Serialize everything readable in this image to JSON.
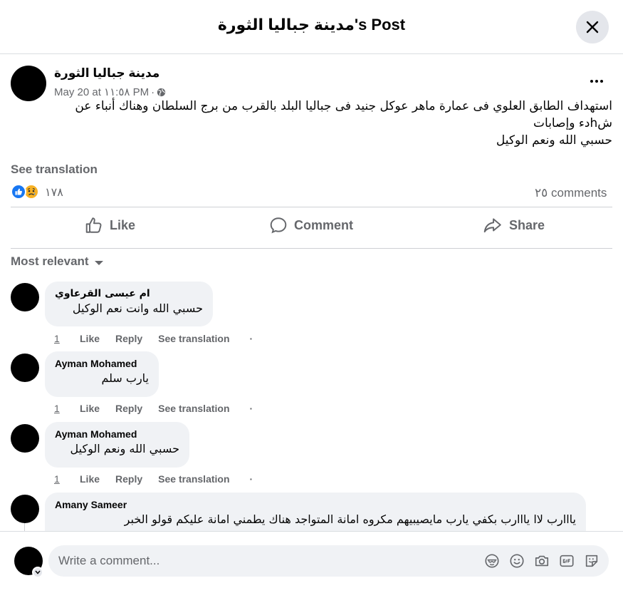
{
  "header": {
    "title": "مدينة جباليا الثورة's Post"
  },
  "post": {
    "author": "مدينة جباليا الثورة",
    "date": "May 20 at ١١:٥٨ PM",
    "separator": "·",
    "privacy_icon": "globe-icon",
    "text_line1": "استهداف الطابق العلوي فى عمارة ماهر عوكل جنيد فى جباليا البلد بالقرب من برج السلطان وهناك أنباء عن",
    "text_line2": "شhدء وإصابات",
    "text_line3": "حسبي الله ونعم الوكيل",
    "see_translation": "See translation",
    "reaction_count": "١٧٨",
    "comments_count": "٢٥ comments"
  },
  "actions": {
    "like": "Like",
    "comment": "Comment",
    "share": "Share"
  },
  "sort": {
    "label": "Most relevant"
  },
  "comments": [
    {
      "name": "ام عيسى القرعاوي",
      "text": "حسبي الله وانت نعم الوكيل",
      "time": "1",
      "like": "Like",
      "reply": "Reply",
      "translate": "See translation",
      "dot": "·"
    },
    {
      "name": "Ayman Mohamed",
      "text": "يارب سلم",
      "time": "1",
      "like": "Like",
      "reply": "Reply",
      "translate": "See translation",
      "dot": "·"
    },
    {
      "name": "Ayman Mohamed",
      "text": "حسبي الله ونعم الوكيل",
      "time": "1",
      "like": "Like",
      "reply": "Reply",
      "translate": "See translation",
      "dot": "·"
    },
    {
      "name": "Amany Sameer",
      "text": "يااارب لاا يااارب بكفي يارب مايصيبيهم مكروه امانة المتواجد هناك يطمني امانة عليكم قولو الخبر"
    }
  ],
  "composer": {
    "placeholder": "Write a comment...",
    "icons": [
      "avatar-sticker-icon",
      "emoji-icon",
      "camera-icon",
      "gif-icon",
      "sticker-icon"
    ]
  },
  "colors": {
    "accent": "#1877f2",
    "secondary_text": "#65676b",
    "bubble_bg": "#f0f2f5",
    "divider": "#ced0d4"
  }
}
